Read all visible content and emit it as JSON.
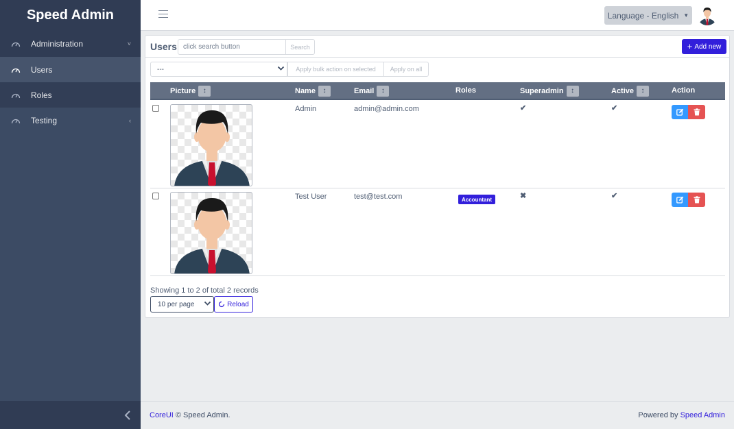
{
  "sidebar": {
    "brand": "Speed Admin",
    "items": [
      {
        "label": "Administration",
        "icon": "speedometer-icon",
        "chevron": "˅"
      },
      {
        "label": "Users",
        "icon": "speedometer-icon"
      },
      {
        "label": "Roles",
        "icon": "speedometer-icon"
      },
      {
        "label": "Testing",
        "icon": "speedometer-icon",
        "chevron": "‹"
      }
    ],
    "minimize_icon": "‹"
  },
  "header": {
    "language_label": "Language - English"
  },
  "users": {
    "title": "Users",
    "search_placeholder": "click search button",
    "search_button": "Search",
    "add_new": "Add new",
    "bulk_select_value": "---",
    "bulk_selected_button": "Apply bulk action on selected",
    "bulk_all_button": "Apply on all",
    "columns": {
      "picture": "Picture",
      "name": "Name",
      "email": "Email",
      "roles": "Roles",
      "superadmin": "Superadmin",
      "active": "Active",
      "action": "Action"
    },
    "rows": [
      {
        "name": "Admin",
        "email": "admin@admin.com",
        "roles": [],
        "superadmin": "✔",
        "active": "✔"
      },
      {
        "name": "Test User",
        "email": "test@test.com",
        "roles": [
          "Accountant"
        ],
        "superadmin": "✖",
        "active": "✔"
      }
    ],
    "showing_text": "Showing 1 to 2 of total 2 records",
    "per_page_value": "10 per page",
    "reload_button": "Reload"
  },
  "footer": {
    "left_link": "CoreUI",
    "left_text": " © Speed Admin.",
    "right_text": "Powered by ",
    "right_link": "Speed Admin"
  },
  "colors": {
    "sidebar_bg": "#3c4b64",
    "primary": "#321fdb",
    "info": "#3399ff",
    "danger": "#e55353",
    "success": "#2eb85c"
  }
}
